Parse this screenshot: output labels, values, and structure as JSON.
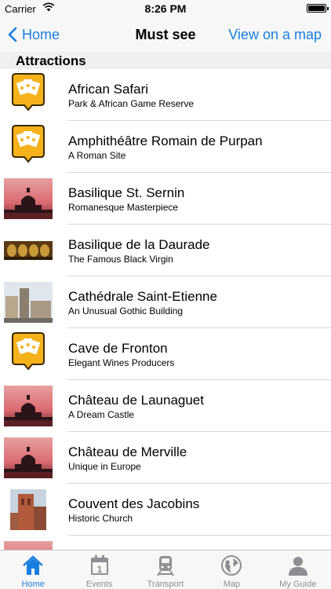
{
  "status_bar": {
    "carrier": "Carrier",
    "time": "8:26 PM"
  },
  "nav": {
    "back_label": "Home",
    "title": "Must see",
    "right_label": "View on a map"
  },
  "section": {
    "title": "Attractions"
  },
  "items": [
    {
      "title": "African Safari",
      "subtitle": "Park & African Game Reserve",
      "thumb": "badge"
    },
    {
      "title": "Amphithéâtre Romain de Purpan",
      "subtitle": "A Roman Site",
      "thumb": "badge"
    },
    {
      "title": "Basilique St. Sernin",
      "subtitle": "Romanesque Masterpiece",
      "thumb": "sunset"
    },
    {
      "title": "Basilique de la Daurade",
      "subtitle": "The Famous Black Virgin",
      "thumb": "interior"
    },
    {
      "title": "Cathédrale Saint-Etienne",
      "subtitle": "An Unusual Gothic Building",
      "thumb": "street"
    },
    {
      "title": "Cave de Fronton",
      "subtitle": "Elegant Wines Producers",
      "thumb": "badge"
    },
    {
      "title": "Château de Launaguet",
      "subtitle": "A Dream Castle",
      "thumb": "sunset"
    },
    {
      "title": "Château de Merville",
      "subtitle": "Unique in Europe",
      "thumb": "sunset"
    },
    {
      "title": "Couvent des Jacobins",
      "subtitle": "Historic Church",
      "thumb": "tower"
    },
    {
      "title": "",
      "subtitle": "",
      "thumb": "sunset"
    }
  ],
  "tabs": [
    {
      "label": "Home",
      "icon": "home-icon",
      "active": true
    },
    {
      "label": "Events",
      "icon": "calendar-icon",
      "active": false
    },
    {
      "label": "Transport",
      "icon": "train-icon",
      "active": false
    },
    {
      "label": "Map",
      "icon": "globe-icon",
      "active": false
    },
    {
      "label": "My Guide",
      "icon": "user-icon",
      "active": false
    }
  ],
  "colors": {
    "accent": "#1a7ee0",
    "badge": "#f5b21b",
    "inactive": "#8e8e93"
  }
}
